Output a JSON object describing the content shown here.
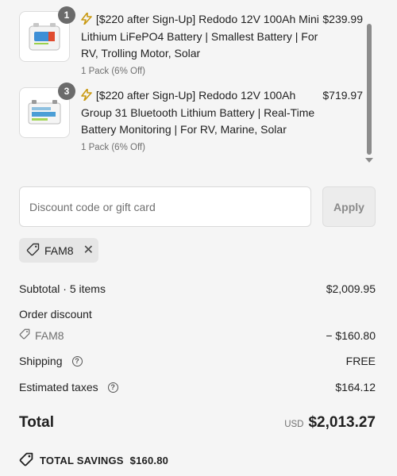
{
  "products": [
    {
      "qty_badge": "1",
      "promo_prefix": "[$220 after Sign-Up]",
      "title": "Redodo 12V 100Ah Mini Lithium LiFePO4 Battery | Smallest Battery | For RV, Trolling Motor, Solar",
      "variant": "1 Pack (6% Off)",
      "price": "$239.99",
      "thumb_icon": "mini-battery-image"
    },
    {
      "qty_badge": "3",
      "promo_prefix": "[$220 after Sign-Up]",
      "title": "Redodo 12V 100Ah Group 31 Bluetooth Lithium Battery | Real-Time Battery Monitoring | For RV, Marine, Solar",
      "variant": "1 Pack (6% Off)",
      "price": "$719.97",
      "thumb_icon": "group31-battery-image"
    }
  ],
  "discount": {
    "placeholder": "Discount code or gift card",
    "value": "",
    "apply_label": "Apply",
    "applied_code": "FAM8"
  },
  "summary": {
    "subtotal_label": "Subtotal · 5 items",
    "subtotal_value": "$2,009.95",
    "order_discount_label": "Order discount",
    "order_discount_code": "FAM8",
    "order_discount_value": "− $160.80",
    "shipping_label": "Shipping",
    "shipping_value": "FREE",
    "taxes_label": "Estimated taxes",
    "taxes_value": "$164.12",
    "total_label": "Total",
    "currency": "USD",
    "total_value": "$2,013.27",
    "savings_label": "TOTAL SAVINGS",
    "savings_value": "$160.80"
  },
  "colors": {
    "background": "#f5f5f5",
    "bolt": "#c99a12",
    "muted_text": "#707070"
  }
}
